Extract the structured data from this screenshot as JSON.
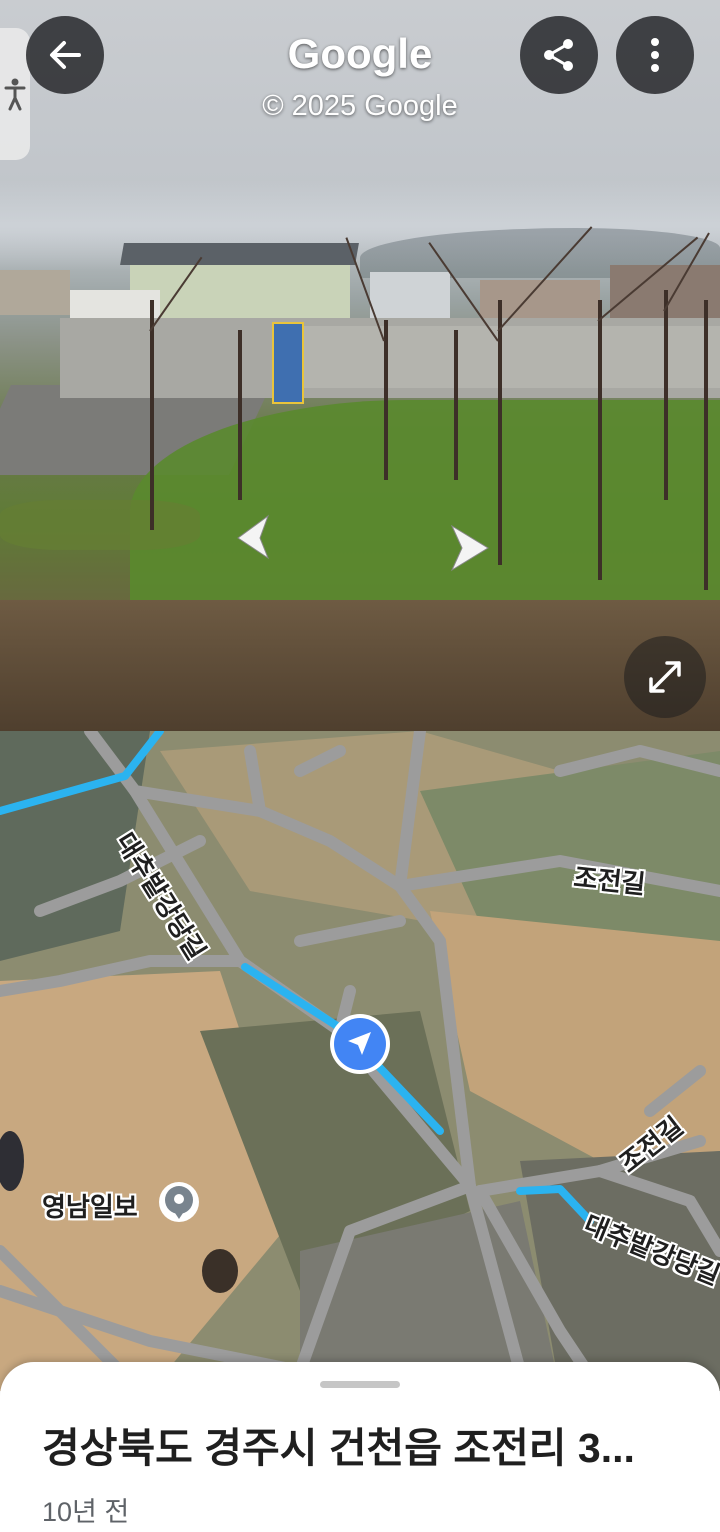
{
  "street_view": {
    "title": "Google",
    "copyright": "© 2025 Google"
  },
  "icons": {
    "back": "arrow-left",
    "share": "share",
    "more": "more-vertical",
    "accessibility": "person-standing",
    "prev": "chevron-left",
    "next": "chevron-right",
    "expand": "expand-diagonal",
    "location": "navigation-arrow",
    "poi": "place-pin"
  },
  "map": {
    "labels": {
      "road_a": "대추밭강당길",
      "road_b": "조전길",
      "road_c": "조전길",
      "road_d": "대추밭강당길",
      "poi": "영남일보"
    },
    "colors": {
      "route": "#2bb3f0",
      "location_dot": "#4285f4",
      "road": "#9c9c9c"
    }
  },
  "sheet": {
    "address": "경상북도 경주시 건천읍 조전리 3...",
    "time_ago": "10년 전"
  }
}
